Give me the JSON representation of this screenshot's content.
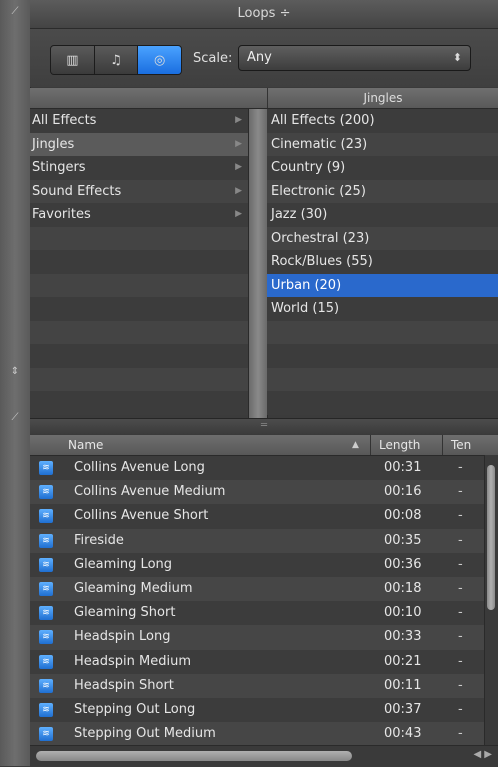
{
  "window": {
    "title": "Loops ÷"
  },
  "toolbar": {
    "view_buttons": [
      {
        "icon": "grid-view-icon",
        "glyph": "▥"
      },
      {
        "icon": "music-note-icon",
        "glyph": "♫"
      },
      {
        "icon": "podcast-icon",
        "glyph": "◎"
      }
    ],
    "scale_label": "Scale:",
    "scale_value": "Any",
    "scale_arrows": "⬍"
  },
  "browser": {
    "right_header": "Jingles",
    "categories": [
      {
        "label": "All Effects",
        "arrow": "▶"
      },
      {
        "label": "Jingles",
        "arrow": "▶"
      },
      {
        "label": "Stingers",
        "arrow": "▶"
      },
      {
        "label": "Sound Effects",
        "arrow": "▶"
      },
      {
        "label": "Favorites",
        "arrow": "▶"
      }
    ],
    "selected_category": "Jingles",
    "subcategories": [
      "All Effects (200)",
      "Cinematic (23)",
      "Country (9)",
      "Electronic (25)",
      "Jazz (30)",
      "Orchestral (23)",
      "Rock/Blues (55)",
      "Urban (20)",
      "World (15)"
    ],
    "selected_subcategory": "Urban (20)"
  },
  "results": {
    "columns": {
      "name": "Name",
      "sort_indicator": "▲",
      "length": "Length",
      "tempo": "Ten"
    },
    "rows": [
      {
        "name": "Collins Avenue Long",
        "length": "00:31",
        "tempo": "-"
      },
      {
        "name": "Collins Avenue Medium",
        "length": "00:16",
        "tempo": "-"
      },
      {
        "name": "Collins Avenue Short",
        "length": "00:08",
        "tempo": "-"
      },
      {
        "name": "Fireside",
        "length": "00:35",
        "tempo": "-"
      },
      {
        "name": "Gleaming Long",
        "length": "00:36",
        "tempo": "-"
      },
      {
        "name": "Gleaming Medium",
        "length": "00:18",
        "tempo": "-"
      },
      {
        "name": "Gleaming Short",
        "length": "00:10",
        "tempo": "-"
      },
      {
        "name": "Headspin Long",
        "length": "00:33",
        "tempo": "-"
      },
      {
        "name": "Headspin Medium",
        "length": "00:21",
        "tempo": "-"
      },
      {
        "name": "Headspin Short",
        "length": "00:11",
        "tempo": "-"
      },
      {
        "name": "Stepping Out Long",
        "length": "00:37",
        "tempo": "-"
      },
      {
        "name": "Stepping Out Medium",
        "length": "00:43",
        "tempo": "-"
      }
    ]
  },
  "colors": {
    "selection_blue": "#2a69cc",
    "accent_blue": "#1f6fd1"
  }
}
